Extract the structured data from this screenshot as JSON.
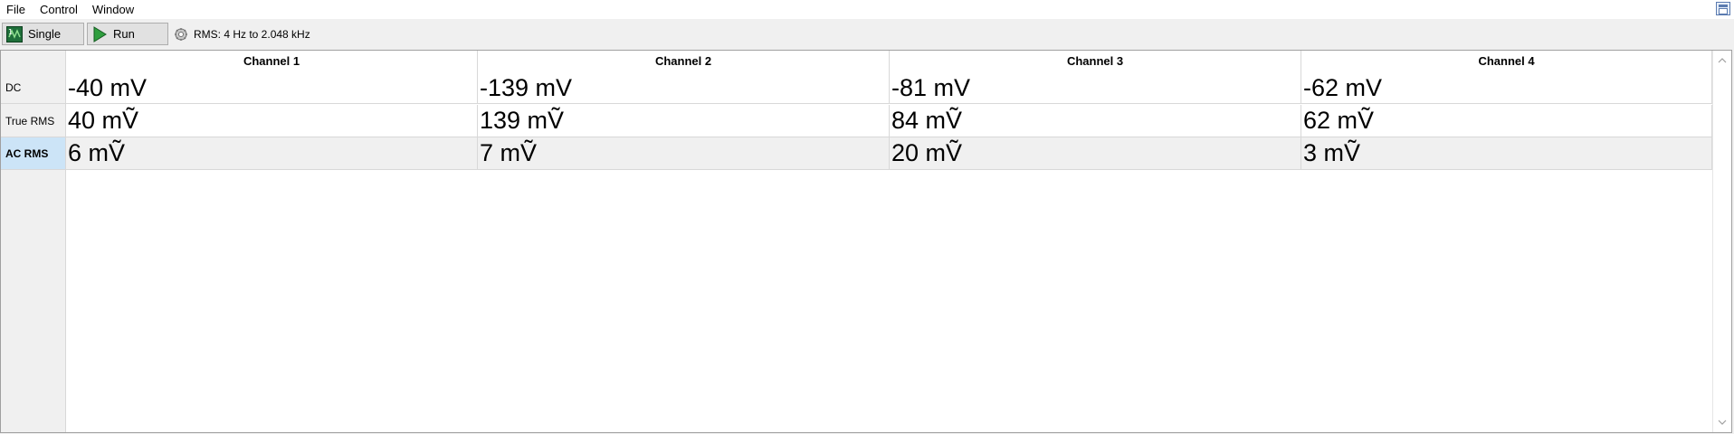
{
  "menu": {
    "file": "File",
    "control": "Control",
    "window": "Window"
  },
  "toolbar": {
    "single_label": "Single",
    "run_label": "Run",
    "status_text": "RMS: 4 Hz to 2.048 kHz"
  },
  "table": {
    "columns": [
      "Channel 1",
      "Channel 2",
      "Channel 3",
      "Channel 4"
    ],
    "rows": [
      {
        "label": "DC",
        "values": [
          "-40 mV",
          "-139 mV",
          "-81 mV",
          "-62 mV"
        ]
      },
      {
        "label": "True RMS",
        "values": [
          "40 mṼ",
          "139 mṼ",
          "84 mṼ",
          "62 mṼ"
        ]
      },
      {
        "label": "AC RMS",
        "values": [
          "6 mṼ",
          "7 mṼ",
          "20 mṼ",
          "3 mṼ"
        ]
      }
    ],
    "selected_row": "AC RMS"
  },
  "icons": {
    "single": "single-shot-icon",
    "run": "play-icon",
    "status": "gear-settings-icon",
    "window": "window-restore-icon"
  },
  "colors": {
    "selected_row": "#cce4f7",
    "run_icon": "#2e9e3e"
  }
}
